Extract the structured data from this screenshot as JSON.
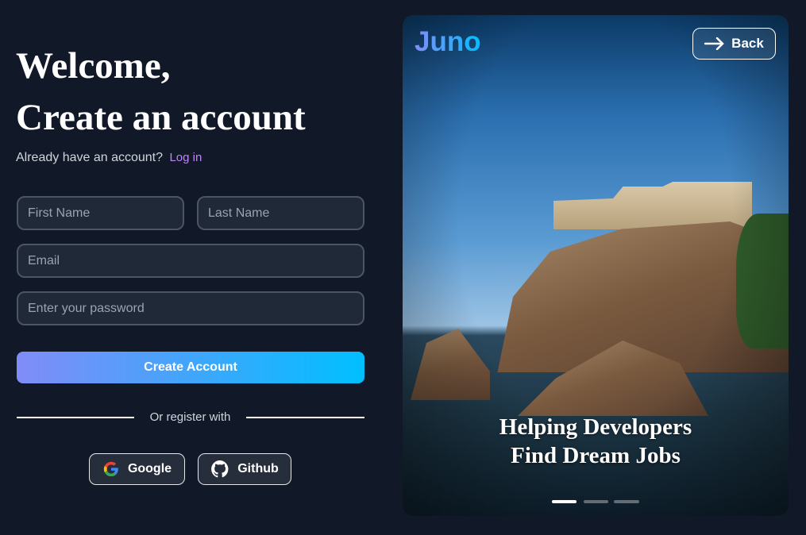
{
  "heading": {
    "line1": "Welcome,",
    "line2": "Create an account"
  },
  "login_prompt": {
    "text": "Already have an account?",
    "link": "Log in"
  },
  "form": {
    "first_name_placeholder": "First Name",
    "last_name_placeholder": "Last Name",
    "email_placeholder": "Email",
    "password_placeholder": "Enter your password",
    "submit_label": "Create Account"
  },
  "divider_text": "Or register with",
  "social": {
    "google": "Google",
    "github": "Github"
  },
  "hero": {
    "logo": "Juno",
    "back_label": "Back",
    "tagline_line1": "Helping Developers",
    "tagline_line2": "Find Dream Jobs",
    "carousel": {
      "count": 3,
      "active": 0
    }
  },
  "colors": {
    "background": "#111827",
    "accent_start": "#818cf8",
    "accent_end": "#00bfff",
    "link": "#c084fc"
  }
}
